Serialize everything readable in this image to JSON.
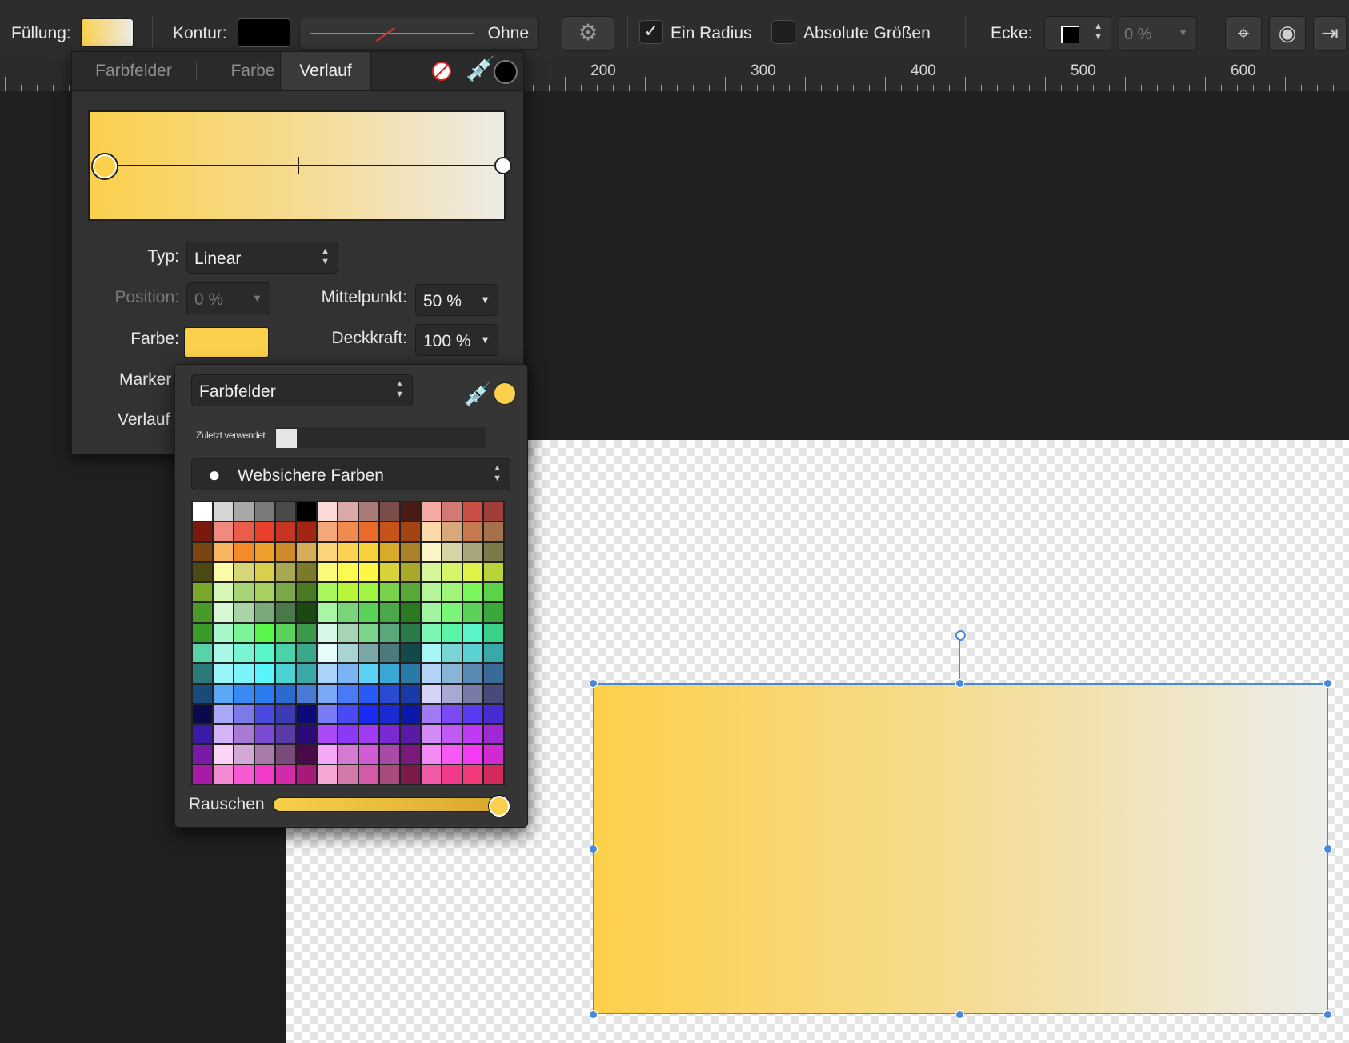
{
  "toolbar": {
    "fill_label": "Füllung:",
    "stroke_label": "Kontur:",
    "stroke_style_value": "Ohne",
    "one_radius_label": "Ein Radius",
    "one_radius_checked": true,
    "absolute_sizes_label": "Absolute Größen",
    "absolute_sizes_checked": false,
    "corner_label": "Ecke:",
    "corner_percent_value": "0 %",
    "fill_color": "#fbd04c",
    "stroke_color": "#000000"
  },
  "ruler": {
    "labels": [
      "200",
      "300",
      "400",
      "500",
      "600"
    ]
  },
  "gradient_panel": {
    "tabs": [
      "Farbfelder",
      "Farbe",
      "Verlauf"
    ],
    "active_tab": "Verlauf",
    "type_label": "Typ:",
    "type_value": "Linear",
    "position_label": "Position:",
    "position_value": "0 %",
    "midpoint_label": "Mittelpunkt:",
    "midpoint_value": "50 %",
    "color_label": "Farbe:",
    "opacity_label": "Deckkraft:",
    "opacity_value": "100 %",
    "marker_label": "Marker",
    "gradient_label": "Verlauf",
    "stop_color": "#fbd04c",
    "end_color": "#eeebe6"
  },
  "swatches_popover": {
    "mode_value": "Farbfelder",
    "recent_label": "Zuletzt verwendet",
    "palette_value": "Websichere Farben",
    "noise_label": "Rauschen",
    "current_color": "#fbd04c",
    "swatches": [
      [
        "#ffffff",
        "#d6d6d6",
        "#a8a8a8",
        "#7a7a7a",
        "#4a4a4a",
        "#000000",
        "#fbd9d6",
        "#d9aaa6",
        "#a87b77",
        "#7a4d4a",
        "#4a1a15",
        "#f4aba5",
        "#d17a74",
        "#c94e46",
        "#a03f39"
      ],
      [
        "#7a1a0d",
        "#f08a7f",
        "#ea5c4c",
        "#e8402b",
        "#c7341f",
        "#a42513",
        "#f4a87a",
        "#f08a4e",
        "#ea6a2a",
        "#c7531a",
        "#a44511",
        "#fbd9ab",
        "#d7a87a",
        "#c7784c",
        "#a5714a"
      ],
      [
        "#7a4512",
        "#f7b562",
        "#f48b2a",
        "#f0a02a",
        "#cf8a2a",
        "#d4ac5a",
        "#fbd47a",
        "#fbd252",
        "#f8d23a",
        "#d8ac2a",
        "#a8812a",
        "#fdf5c8",
        "#d7d4a8",
        "#a8a67a",
        "#7a7a4a"
      ],
      [
        "#4a4a12",
        "#fdfaa8",
        "#d7d678",
        "#d7d04a",
        "#a8a852",
        "#7a7a2a",
        "#fdfa7a",
        "#fdfa52",
        "#fbf84a",
        "#d8d23a",
        "#a8a82a",
        "#d7f59a",
        "#d7f56a",
        "#e0f34a",
        "#b7d43a"
      ],
      [
        "#7aa82a",
        "#d7f7b4",
        "#a8d478",
        "#a8d060",
        "#7aa848",
        "#4a7a22",
        "#a8f55c",
        "#b7f53a",
        "#a0f542",
        "#7ad24a",
        "#5aa83a",
        "#b7f59a",
        "#a0f57a",
        "#7af55a",
        "#5ad24a"
      ],
      [
        "#4a9a2a",
        "#d7f7d4",
        "#a8d4a8",
        "#7aa87a",
        "#4a7a4a",
        "#1a4a12",
        "#a8f5a8",
        "#7ad47a",
        "#5ad25a",
        "#4aa84a",
        "#2a7a22",
        "#a0f5a0",
        "#7af57a",
        "#5ad25a",
        "#3aa83a"
      ],
      [
        "#3a9a2a",
        "#a8f7c8",
        "#7af59a",
        "#5af54a",
        "#5ad25a",
        "#3a9a4a",
        "#d7f7e8",
        "#a8d4b4",
        "#7ad48a",
        "#5aa87a",
        "#2a7a4a",
        "#7af5b4",
        "#5af5a8",
        "#5af5c8",
        "#3ad28a"
      ],
      [
        "#5ad2a8",
        "#a8f7e8",
        "#7af5d4",
        "#5af5c8",
        "#4ad2a8",
        "#3aa88a",
        "#e8fbfb",
        "#a8d4d4",
        "#7aa8a8",
        "#4a7a7a",
        "#124a4a",
        "#a8f5f5",
        "#7ad4d4",
        "#5ad2d2",
        "#3aa8a8"
      ],
      [
        "#2a7a7a",
        "#9af5fb",
        "#7af5fb",
        "#5af5fb",
        "#4ad2d4",
        "#3aa8a8",
        "#a8d4f7",
        "#7ab4f5",
        "#5ad2f5",
        "#3aa8d4",
        "#2a7aa8",
        "#b4d4f7",
        "#8ab4d4",
        "#5a8ab4",
        "#3a6a9a"
      ],
      [
        "#1a4a7a",
        "#5aa8f5",
        "#3a8af5",
        "#2a7af0",
        "#2a6ad2",
        "#4a7ad4",
        "#7aa8f7",
        "#4a7af5",
        "#2a5af5",
        "#2a4ad2",
        "#1a3aa8",
        "#d4d4f7",
        "#a8a8d4",
        "#7a7aa8",
        "#4a4a7a"
      ],
      [
        "#0a0a4a",
        "#a8a8f7",
        "#7a7ae8",
        "#4a4ae0",
        "#3a3ab4",
        "#0a0a7a",
        "#7a7af5",
        "#4a4af5",
        "#1a2af5",
        "#1a2ad2",
        "#0a1aa8",
        "#a07af5",
        "#7a4af5",
        "#5a3af0",
        "#4a2ad2"
      ],
      [
        "#3a1aa8",
        "#d4b4f7",
        "#a87ad4",
        "#7a4ad2",
        "#5a3aa8",
        "#2a0a7a",
        "#a84af5",
        "#8a3af5",
        "#a03af5",
        "#7a2ad2",
        "#5a1aa8",
        "#d28af5",
        "#c05af5",
        "#c03af5",
        "#a02ad2"
      ],
      [
        "#7a1aa8",
        "#fbd4f7",
        "#d4a8d4",
        "#a87aa8",
        "#7a4a7a",
        "#4a0a4a",
        "#f5a8f5",
        "#d47ad4",
        "#d25ad2",
        "#a84aa8",
        "#7a1a7a",
        "#f58af5",
        "#f55af5",
        "#f53af5",
        "#d22ad2"
      ],
      [
        "#a81aa8",
        "#f58ad4",
        "#f55ad2",
        "#f03ac8",
        "#d22aa8",
        "#a81a7a",
        "#f5a8d4",
        "#d47aa8",
        "#d25aa8",
        "#a84a7a",
        "#7a1a4a",
        "#f05aa8",
        "#f03a8a",
        "#f03a7a",
        "#d22a5a"
      ]
    ]
  }
}
